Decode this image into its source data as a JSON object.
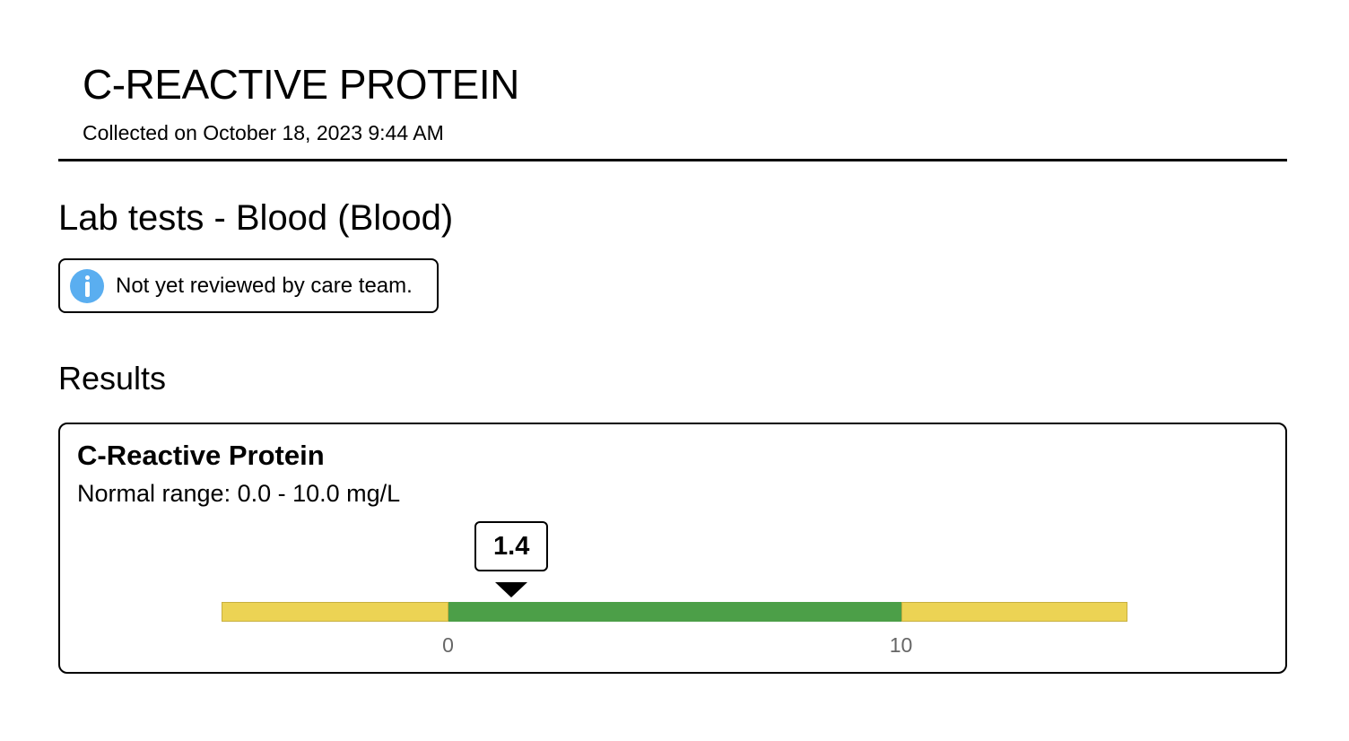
{
  "header": {
    "title": "C-REACTIVE PROTEIN",
    "collected": "Collected on October 18, 2023 9:44 AM"
  },
  "section": {
    "title": "Lab tests - Blood (Blood)"
  },
  "review_banner": {
    "icon": "info-icon",
    "text": "Not yet reviewed by care team."
  },
  "results": {
    "title": "Results",
    "items": [
      {
        "name": "C-Reactive Protein",
        "normal_range_text": "Normal range: 0.0 - 10.0 mg/L",
        "value": 1.4,
        "value_label": "1.4",
        "range_min": 0,
        "range_max": 10,
        "scale_min": -5,
        "scale_max": 15,
        "tick_labels": [
          "0",
          "10"
        ],
        "colors": {
          "normal": "#4c9f48",
          "out_of_range": "#ecd354"
        }
      }
    ]
  }
}
